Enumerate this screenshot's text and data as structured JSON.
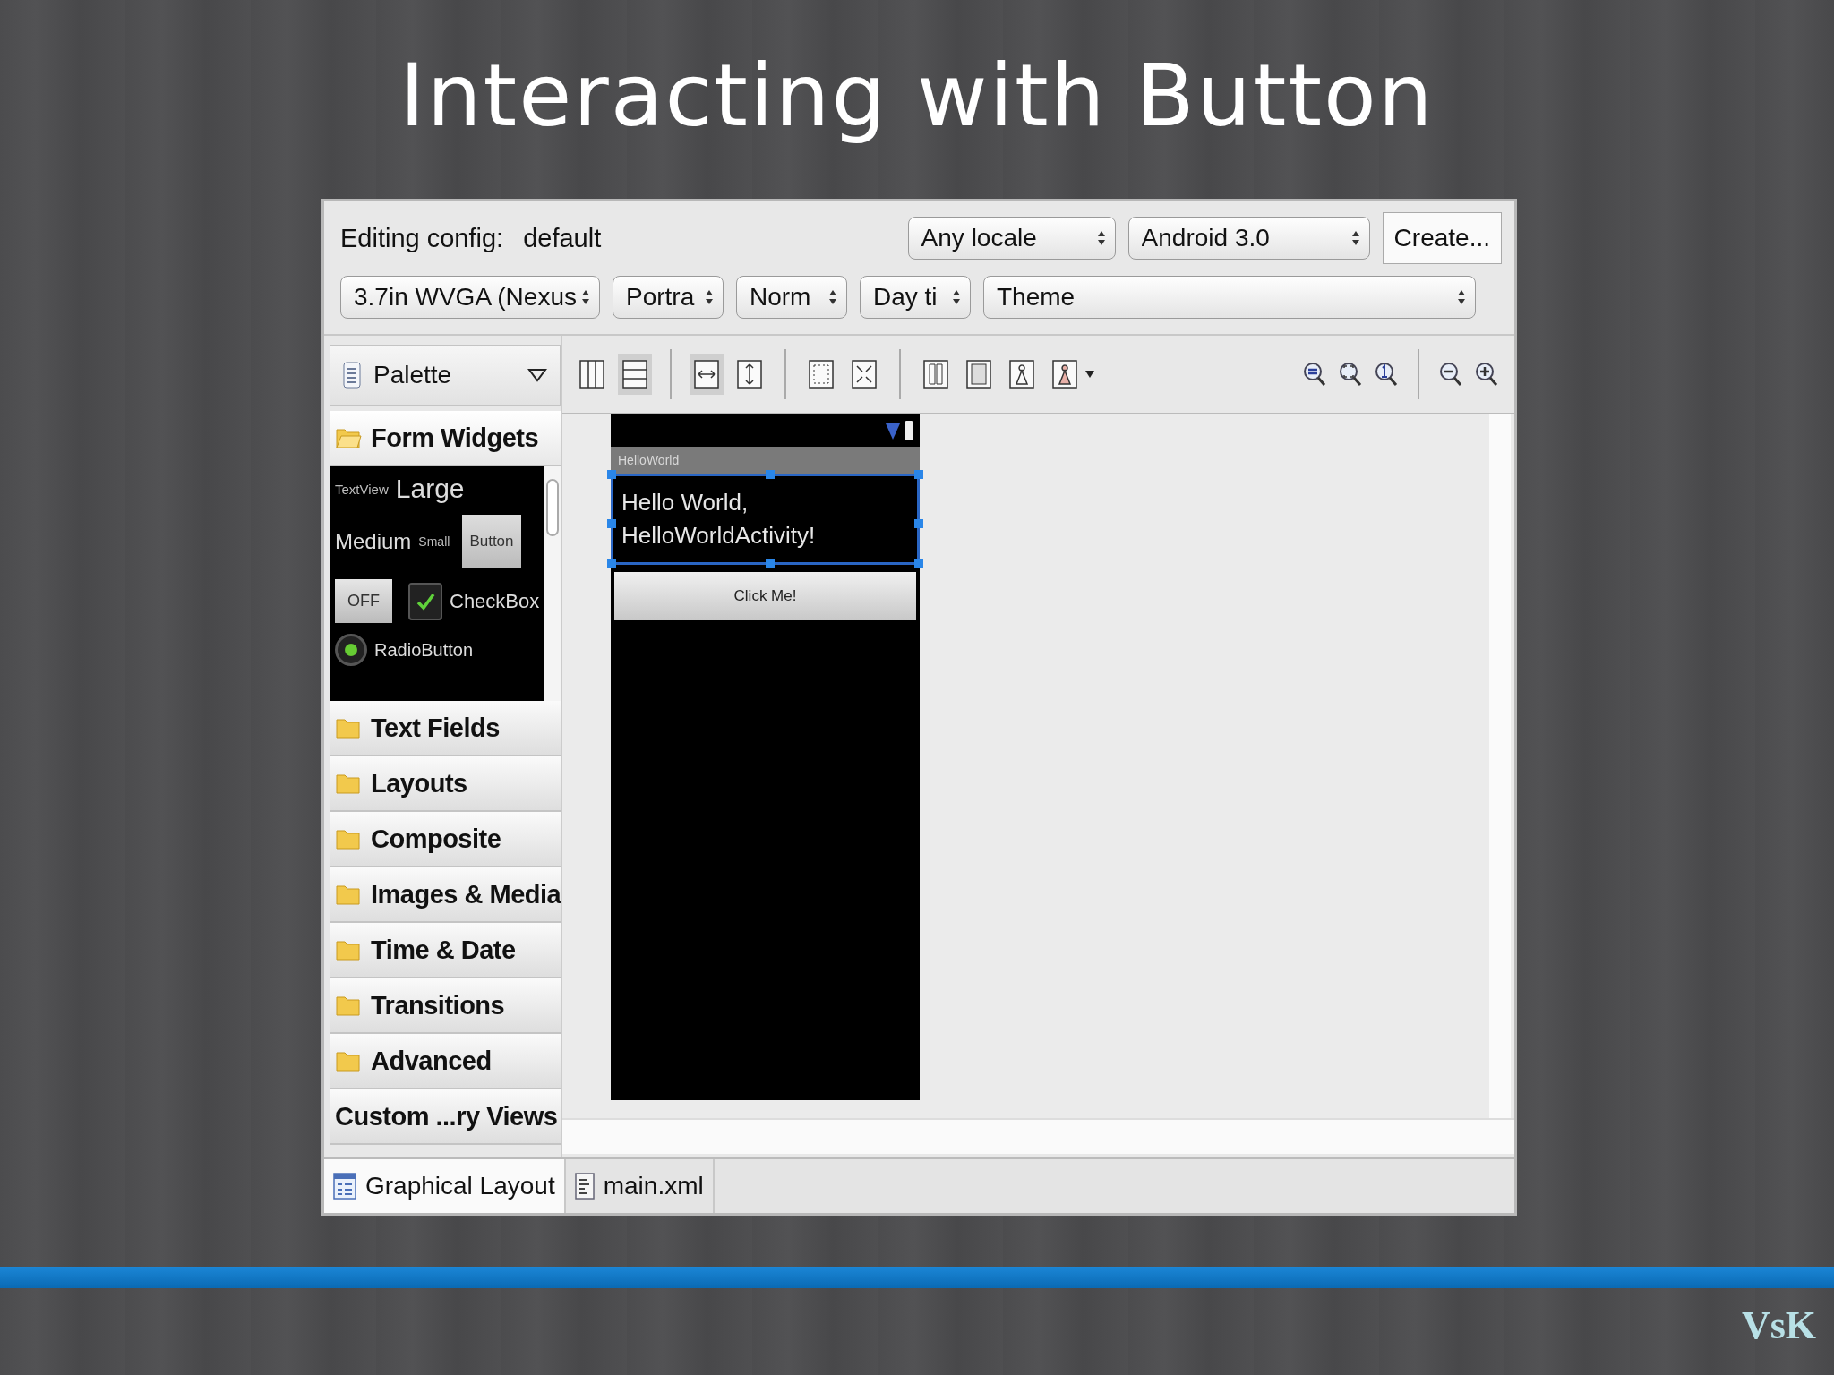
{
  "slide_title": "Interacting with Button",
  "config": {
    "label": "Editing config:",
    "value": "default",
    "create_button": "Create...",
    "row1": [
      {
        "label": "Any locale"
      },
      {
        "label": "Android 3.0"
      }
    ],
    "row2": [
      {
        "label": "3.7in WVGA (Nexus"
      },
      {
        "label": "Portra"
      },
      {
        "label": "Norm"
      },
      {
        "label": "Day ti"
      },
      {
        "label": "Theme"
      }
    ]
  },
  "palette": {
    "title": "Palette",
    "sections": [
      {
        "label": "Form Widgets",
        "kind": "folder",
        "expanded": true
      },
      {
        "label": "Text Fields",
        "kind": "folder",
        "expanded": false
      },
      {
        "label": "Layouts",
        "kind": "folder",
        "expanded": false
      },
      {
        "label": "Composite",
        "kind": "folder",
        "expanded": false
      },
      {
        "label": "Images & Media",
        "kind": "folder",
        "expanded": false
      },
      {
        "label": "Time & Date",
        "kind": "folder",
        "expanded": false
      },
      {
        "label": "Transitions",
        "kind": "folder",
        "expanded": false
      },
      {
        "label": "Advanced",
        "kind": "folder",
        "expanded": false
      },
      {
        "label": "Custom ...ry Views",
        "kind": "plain",
        "expanded": false
      }
    ],
    "preview": {
      "textview": "TextView",
      "large": "Large",
      "medium": "Medium",
      "small": "Small",
      "button": "Button",
      "toggle": "OFF",
      "checkbox": {
        "label": "CheckBox",
        "checked": true
      },
      "radio": {
        "label": "RadioButton",
        "checked": true
      }
    }
  },
  "toolbar": [
    {
      "kind": "columns",
      "selected": false
    },
    {
      "kind": "rows",
      "selected": true
    },
    {
      "kind": "sep"
    },
    {
      "kind": "hfill",
      "selected": true
    },
    {
      "kind": "vfill",
      "selected": false
    },
    {
      "kind": "sep"
    },
    {
      "kind": "margins",
      "selected": false
    },
    {
      "kind": "expand",
      "selected": false
    },
    {
      "kind": "sep"
    },
    {
      "kind": "split",
      "selected": false
    },
    {
      "kind": "frame",
      "selected": false
    },
    {
      "kind": "person",
      "selected": false
    },
    {
      "kind": "person2",
      "selected": false
    }
  ],
  "zoom_tools": [
    {
      "kind": "fit"
    },
    {
      "kind": "real"
    },
    {
      "kind": "one"
    },
    {
      "kind": "sep"
    },
    {
      "kind": "out"
    },
    {
      "kind": "in"
    }
  ],
  "phone": {
    "app_title": "HelloWorld",
    "text": "Hello World, HelloWorldActivity!",
    "text_selected": true,
    "button": "Click Me!"
  },
  "editor_tabs": [
    {
      "label": "Graphical Layout",
      "selected": true
    },
    {
      "label": "main.xml",
      "selected": false
    }
  ],
  "footer": {
    "mark": "VsK"
  }
}
